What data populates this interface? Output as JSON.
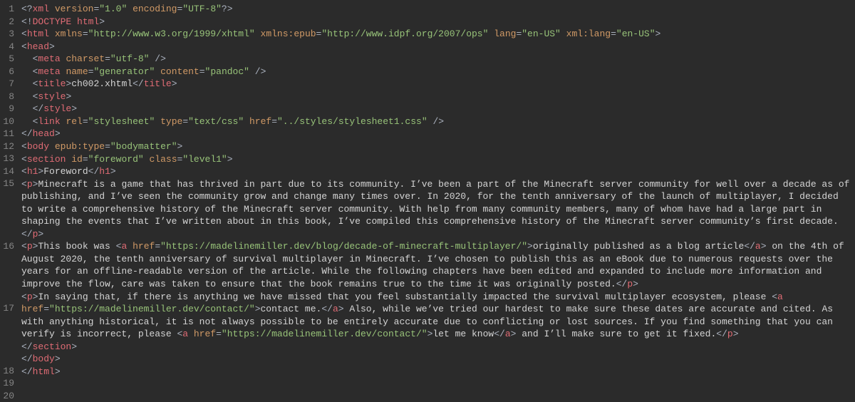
{
  "lines": [
    {
      "n": 1,
      "tokens": [
        {
          "c": "br",
          "t": "<?"
        },
        {
          "c": "tag",
          "t": "xml"
        },
        {
          "c": "tx",
          "t": " "
        },
        {
          "c": "at",
          "t": "version"
        },
        {
          "c": "eq",
          "t": "="
        },
        {
          "c": "st",
          "t": "\"1.0\""
        },
        {
          "c": "tx",
          "t": " "
        },
        {
          "c": "at",
          "t": "encoding"
        },
        {
          "c": "eq",
          "t": "="
        },
        {
          "c": "st",
          "t": "\"UTF-8\""
        },
        {
          "c": "br",
          "t": "?>"
        }
      ]
    },
    {
      "n": 2,
      "tokens": [
        {
          "c": "br",
          "t": "<!"
        },
        {
          "c": "tag",
          "t": "DOCTYPE html"
        },
        {
          "c": "br",
          "t": ">"
        }
      ]
    },
    {
      "n": 3,
      "tokens": [
        {
          "c": "br",
          "t": "<"
        },
        {
          "c": "tag",
          "t": "html"
        },
        {
          "c": "tx",
          "t": " "
        },
        {
          "c": "at",
          "t": "xmlns"
        },
        {
          "c": "eq",
          "t": "="
        },
        {
          "c": "st",
          "t": "\"http://www.w3.org/1999/xhtml\""
        },
        {
          "c": "tx",
          "t": " "
        },
        {
          "c": "at",
          "t": "xmlns:epub"
        },
        {
          "c": "eq",
          "t": "="
        },
        {
          "c": "st",
          "t": "\"http://www.idpf.org/2007/ops\""
        },
        {
          "c": "tx",
          "t": " "
        },
        {
          "c": "at",
          "t": "lang"
        },
        {
          "c": "eq",
          "t": "="
        },
        {
          "c": "st",
          "t": "\"en-US\""
        },
        {
          "c": "tx",
          "t": " "
        },
        {
          "c": "at",
          "t": "xml:lang"
        },
        {
          "c": "eq",
          "t": "="
        },
        {
          "c": "st",
          "t": "\"en-US\""
        },
        {
          "c": "br",
          "t": ">"
        }
      ]
    },
    {
      "n": 4,
      "tokens": [
        {
          "c": "br",
          "t": "<"
        },
        {
          "c": "tag",
          "t": "head"
        },
        {
          "c": "br",
          "t": ">"
        }
      ]
    },
    {
      "n": 5,
      "tokens": [
        {
          "c": "tx",
          "t": "  "
        },
        {
          "c": "br",
          "t": "<"
        },
        {
          "c": "tag",
          "t": "meta"
        },
        {
          "c": "tx",
          "t": " "
        },
        {
          "c": "at",
          "t": "charset"
        },
        {
          "c": "eq",
          "t": "="
        },
        {
          "c": "st",
          "t": "\"utf-8\""
        },
        {
          "c": "tx",
          "t": " "
        },
        {
          "c": "br",
          "t": "/>"
        }
      ]
    },
    {
      "n": 6,
      "tokens": [
        {
          "c": "tx",
          "t": "  "
        },
        {
          "c": "br",
          "t": "<"
        },
        {
          "c": "tag",
          "t": "meta"
        },
        {
          "c": "tx",
          "t": " "
        },
        {
          "c": "at",
          "t": "name"
        },
        {
          "c": "eq",
          "t": "="
        },
        {
          "c": "st",
          "t": "\"generator\""
        },
        {
          "c": "tx",
          "t": " "
        },
        {
          "c": "at",
          "t": "content"
        },
        {
          "c": "eq",
          "t": "="
        },
        {
          "c": "st",
          "t": "\"pandoc\""
        },
        {
          "c": "tx",
          "t": " "
        },
        {
          "c": "br",
          "t": "/>"
        }
      ]
    },
    {
      "n": 7,
      "tokens": [
        {
          "c": "tx",
          "t": "  "
        },
        {
          "c": "br",
          "t": "<"
        },
        {
          "c": "tag",
          "t": "title"
        },
        {
          "c": "br",
          "t": ">"
        },
        {
          "c": "tx",
          "t": "ch002.xhtml"
        },
        {
          "c": "br",
          "t": "</"
        },
        {
          "c": "tag",
          "t": "title"
        },
        {
          "c": "br",
          "t": ">"
        }
      ]
    },
    {
      "n": 8,
      "tokens": [
        {
          "c": "tx",
          "t": "  "
        },
        {
          "c": "br",
          "t": "<"
        },
        {
          "c": "tag",
          "t": "style"
        },
        {
          "c": "br",
          "t": ">"
        }
      ]
    },
    {
      "n": 9,
      "tokens": [
        {
          "c": "tx",
          "t": "  "
        },
        {
          "c": "br",
          "t": "</"
        },
        {
          "c": "tag",
          "t": "style"
        },
        {
          "c": "br",
          "t": ">"
        }
      ]
    },
    {
      "n": 10,
      "tokens": [
        {
          "c": "tx",
          "t": "  "
        },
        {
          "c": "br",
          "t": "<"
        },
        {
          "c": "tag",
          "t": "link"
        },
        {
          "c": "tx",
          "t": " "
        },
        {
          "c": "at",
          "t": "rel"
        },
        {
          "c": "eq",
          "t": "="
        },
        {
          "c": "st",
          "t": "\"stylesheet\""
        },
        {
          "c": "tx",
          "t": " "
        },
        {
          "c": "at",
          "t": "type"
        },
        {
          "c": "eq",
          "t": "="
        },
        {
          "c": "st",
          "t": "\"text/css\""
        },
        {
          "c": "tx",
          "t": " "
        },
        {
          "c": "at",
          "t": "href"
        },
        {
          "c": "eq",
          "t": "="
        },
        {
          "c": "st",
          "t": "\"../styles/stylesheet1.css\""
        },
        {
          "c": "tx",
          "t": " "
        },
        {
          "c": "br",
          "t": "/>"
        }
      ]
    },
    {
      "n": 11,
      "tokens": [
        {
          "c": "br",
          "t": "</"
        },
        {
          "c": "tag",
          "t": "head"
        },
        {
          "c": "br",
          "t": ">"
        }
      ]
    },
    {
      "n": 12,
      "tokens": [
        {
          "c": "br",
          "t": "<"
        },
        {
          "c": "tag",
          "t": "body"
        },
        {
          "c": "tx",
          "t": " "
        },
        {
          "c": "at",
          "t": "epub:type"
        },
        {
          "c": "eq",
          "t": "="
        },
        {
          "c": "st",
          "t": "\"bodymatter\""
        },
        {
          "c": "br",
          "t": ">"
        }
      ]
    },
    {
      "n": 13,
      "tokens": [
        {
          "c": "br",
          "t": "<"
        },
        {
          "c": "tag",
          "t": "section"
        },
        {
          "c": "tx",
          "t": " "
        },
        {
          "c": "at",
          "t": "id"
        },
        {
          "c": "eq",
          "t": "="
        },
        {
          "c": "st",
          "t": "\"foreword\""
        },
        {
          "c": "tx",
          "t": " "
        },
        {
          "c": "at",
          "t": "class"
        },
        {
          "c": "eq",
          "t": "="
        },
        {
          "c": "st",
          "t": "\"level1\""
        },
        {
          "c": "br",
          "t": ">"
        }
      ]
    },
    {
      "n": 14,
      "tokens": [
        {
          "c": "br",
          "t": "<"
        },
        {
          "c": "tag",
          "t": "h1"
        },
        {
          "c": "br",
          "t": ">"
        },
        {
          "c": "tx",
          "t": "Foreword"
        },
        {
          "c": "br",
          "t": "</"
        },
        {
          "c": "tag",
          "t": "h1"
        },
        {
          "c": "br",
          "t": ">"
        }
      ]
    },
    {
      "n": 15,
      "tokens": [
        {
          "c": "br",
          "t": "<"
        },
        {
          "c": "tag",
          "t": "p"
        },
        {
          "c": "br",
          "t": ">"
        },
        {
          "c": "tx",
          "t": "Minecraft is a game that has thrived in part due to its community. I’ve been a part of the Minecraft server community for well over a decade as of publishing, and I’ve seen the community grow and change many times over. In 2020, for the tenth anniversary of the launch of multiplayer, I decided to write a comprehensive history of the Minecraft server community. With help from many community members, many of whom have had a large part in shaping the events that I’ve written about in this book, I’ve compiled this comprehensive history of the Minecraft server community’s first decade."
        },
        {
          "c": "br",
          "t": "</"
        },
        {
          "c": "tag",
          "t": "p"
        },
        {
          "c": "br",
          "t": ">"
        }
      ]
    },
    {
      "n": 16,
      "tokens": [
        {
          "c": "br",
          "t": "<"
        },
        {
          "c": "tag",
          "t": "p"
        },
        {
          "c": "br",
          "t": ">"
        },
        {
          "c": "tx",
          "t": "This book was "
        },
        {
          "c": "br",
          "t": "<"
        },
        {
          "c": "tag",
          "t": "a"
        },
        {
          "c": "tx",
          "t": " "
        },
        {
          "c": "at",
          "t": "href"
        },
        {
          "c": "eq",
          "t": "="
        },
        {
          "c": "st",
          "t": "\"https://madelinemiller.dev/blog/decade-of-minecraft-multiplayer/\""
        },
        {
          "c": "br",
          "t": ">"
        },
        {
          "c": "tx",
          "t": "originally published as a blog article"
        },
        {
          "c": "br",
          "t": "</"
        },
        {
          "c": "tag",
          "t": "a"
        },
        {
          "c": "br",
          "t": ">"
        },
        {
          "c": "tx",
          "t": " on the 4th of August 2020, the tenth anniversary of survival multiplayer in Minecraft. I’ve chosen to publish this as an eBook due to numerous requests over the years for an offline-readable version of the article. While the following chapters have been edited and expanded to include more information and improve the flow, care was taken to ensure that the book remains true to the time it was originally posted."
        },
        {
          "c": "br",
          "t": "</"
        },
        {
          "c": "tag",
          "t": "p"
        },
        {
          "c": "br",
          "t": ">"
        }
      ]
    },
    {
      "n": 17,
      "tokens": [
        {
          "c": "br",
          "t": "<"
        },
        {
          "c": "tag",
          "t": "p"
        },
        {
          "c": "br",
          "t": ">"
        },
        {
          "c": "tx",
          "t": "In saying that, if there is anything we have missed that you feel substantially impacted the survival multiplayer ecosystem, please "
        },
        {
          "c": "br",
          "t": "<"
        },
        {
          "c": "tag",
          "t": "a"
        },
        {
          "c": "tx",
          "t": " "
        },
        {
          "c": "at",
          "t": "href"
        },
        {
          "c": "eq",
          "t": "="
        },
        {
          "c": "st",
          "t": "\"https://madelinemiller.dev/contact/\""
        },
        {
          "c": "br",
          "t": ">"
        },
        {
          "c": "tx",
          "t": "contact me."
        },
        {
          "c": "br",
          "t": "</"
        },
        {
          "c": "tag",
          "t": "a"
        },
        {
          "c": "br",
          "t": ">"
        },
        {
          "c": "tx",
          "t": " Also, while we’ve tried our hardest to make sure these dates are accurate and cited. As with anything historical, it is not always possible to be entirely accurate due to conflicting or lost sources. If you find something that you can verify is incorrect, please "
        },
        {
          "c": "br",
          "t": "<"
        },
        {
          "c": "tag",
          "t": "a"
        },
        {
          "c": "tx",
          "t": " "
        },
        {
          "c": "at",
          "t": "href"
        },
        {
          "c": "eq",
          "t": "="
        },
        {
          "c": "st",
          "t": "\"https://madelinemiller.dev/contact/\""
        },
        {
          "c": "br",
          "t": ">"
        },
        {
          "c": "tx",
          "t": "let me know"
        },
        {
          "c": "br",
          "t": "</"
        },
        {
          "c": "tag",
          "t": "a"
        },
        {
          "c": "br",
          "t": ">"
        },
        {
          "c": "tx",
          "t": " and I’ll make sure to get it fixed."
        },
        {
          "c": "br",
          "t": "</"
        },
        {
          "c": "tag",
          "t": "p"
        },
        {
          "c": "br",
          "t": ">"
        }
      ]
    },
    {
      "n": 18,
      "tokens": [
        {
          "c": "br",
          "t": "</"
        },
        {
          "c": "tag",
          "t": "section"
        },
        {
          "c": "br",
          "t": ">"
        }
      ]
    },
    {
      "n": 19,
      "tokens": [
        {
          "c": "br",
          "t": "</"
        },
        {
          "c": "tag",
          "t": "body"
        },
        {
          "c": "br",
          "t": ">"
        }
      ]
    },
    {
      "n": 20,
      "tokens": [
        {
          "c": "br",
          "t": "</"
        },
        {
          "c": "tag",
          "t": "html"
        },
        {
          "c": "br",
          "t": ">"
        }
      ]
    }
  ],
  "wrap_counts": {
    "15": 5,
    "16": 5,
    "17": 5
  }
}
